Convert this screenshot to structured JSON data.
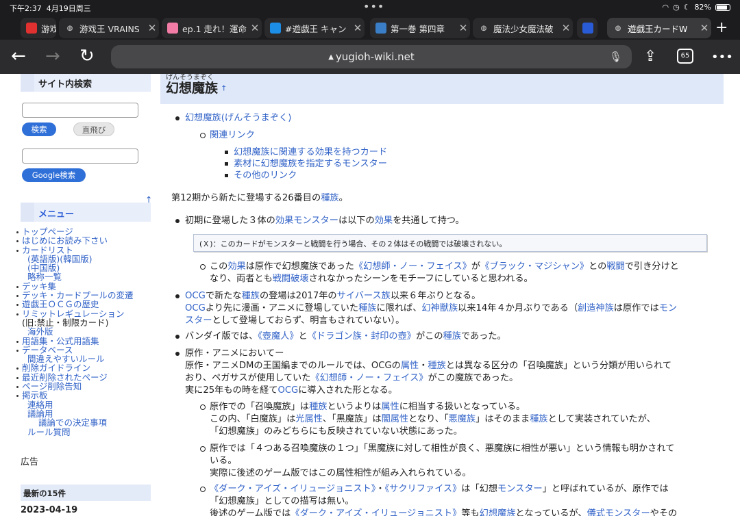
{
  "status": {
    "time": "下午2:37",
    "date": "4月19日周三",
    "battery": "82%"
  },
  "tabs": [
    {
      "label": "游戏",
      "icon": "yugioh-red-icon",
      "color": "#e03030"
    },
    {
      "label": "游戏王 VRAINS",
      "icon": "globe-icon",
      "color": "#888"
    },
    {
      "label": "ep.1 走れ！運命",
      "icon": "bilibili-icon",
      "color": "#f27ca5"
    },
    {
      "label": "#遊戯王 キャン",
      "icon": "pixiv-icon",
      "color": "#1d8ee8"
    },
    {
      "label": "第一巻 第四章",
      "icon": "book-icon",
      "color": "#3a7ec8"
    },
    {
      "label": "魔法少女魔法破",
      "icon": "globe-icon",
      "color": "#888"
    },
    {
      "label": "",
      "icon": "small-blue-icon",
      "color": "#2a5bd7"
    },
    {
      "label": "遊戯王カードW",
      "icon": "globe-icon",
      "color": "#888"
    }
  ],
  "toolbar": {
    "url": "yugioh-wiki.net",
    "tab_count": "65",
    "new_tab": "+"
  },
  "sidebar": {
    "search_title": "サイト内検索",
    "search_btn": "検索",
    "jump_btn": "直飛び",
    "google_btn": "Google検索",
    "up_arrow": "↑",
    "menu_title": "メニュー",
    "menu": [
      {
        "t": "トップページ",
        "k": "b"
      },
      {
        "t": "はじめにお読み下さい",
        "k": "b"
      },
      {
        "t": "カードリスト",
        "k": "b"
      },
      {
        "t": "(英語版)(韓国版)",
        "k": "l2"
      },
      {
        "t": "(中国版)",
        "k": "l2"
      },
      {
        "t": "略称一覧",
        "k": "l2"
      },
      {
        "t": "デッキ集",
        "k": "b"
      },
      {
        "t": "デッキ・カードプールの変遷",
        "k": "b"
      },
      {
        "t": "遊戯王ＯＣＧの歴史",
        "k": "b"
      },
      {
        "t": "リミットレギュレーション",
        "k": "b"
      },
      {
        "t": "(旧:禁止・制限カード)",
        "k": "l1"
      },
      {
        "t": "海外版",
        "k": "l2"
      },
      {
        "t": "用語集・公式用語集",
        "k": "b"
      },
      {
        "t": "データベース",
        "k": "b"
      },
      {
        "t": "間違えやすいルール",
        "k": "l2"
      },
      {
        "t": "削除ガイドライン",
        "k": "b"
      },
      {
        "t": "最近削除されたページ",
        "k": "b"
      },
      {
        "t": "ページ削除告知",
        "k": "b"
      },
      {
        "t": "掲示板",
        "k": "b"
      },
      {
        "t": "連絡用",
        "k": "l2"
      },
      {
        "t": "議論用",
        "k": "l2"
      },
      {
        "t": "議論での決定事項",
        "k": "l3"
      },
      {
        "t": "ルール質問",
        "k": "l2"
      }
    ],
    "ad_label": "広告",
    "recent_title": "最新の15件",
    "recent_date": "2023-04-19"
  },
  "article": {
    "ruby": "げんそうまぞく",
    "title": "幻想魔族",
    "dagger": "†",
    "toc1": "幻想魔族(げんそうまぞく)",
    "toc2": "関連リンク",
    "toc3": [
      "幻想魔族に関連する効果を持つカード",
      "素材に幻想魔族を指定するモンスター",
      "その他のリンク"
    ],
    "intro": [
      "第12期から新たに登場する26番目の",
      "種族",
      "。"
    ],
    "b1": [
      "初期に登場した３体の",
      "効果モンスター",
      "は以下の",
      "効果",
      "を共通して持つ。"
    ],
    "effect": "(Ｘ)：このカードがモンスターと戦闘を行う場合、その２体はその戦闘では破壊されない。",
    "c1a": [
      "この",
      "効果",
      "は原作で幻想魔族であった",
      "《幻想師・ノー・フェイス》",
      "が",
      "《ブラック・マジシャン》",
      "との",
      "戦闘",
      "で引き分けと"
    ],
    "c1b": [
      "なり、両者とも",
      "戦闘破壊",
      "されなかったシーンをモチーフにしていると思われる。"
    ],
    "b2a": [
      "OCG",
      "で新たな",
      "種族",
      "の登場は2017年の",
      "サイバース族",
      "以来６年ぶりとなる。"
    ],
    "b2b": [
      "OCG",
      "より先に漫画・アニメに登場していた",
      "種族",
      "に限れば、",
      "幻神獣族",
      "以来14年４か月ぶりである（",
      "創造神族",
      "は原作では",
      "モン"
    ],
    "b2c": [
      "スター",
      "として登場しておらず、明言もされていない）。"
    ],
    "b3": [
      "バンダイ版では、",
      "《壺魔人》",
      "と",
      "《ドラゴン族・封印の壺》",
      "がこの",
      "種族",
      "であった。"
    ],
    "b4a": "原作・アニメにおいてー",
    "b4b": [
      "原作・アニメDMの王国編までのルールでは、OCGの",
      "属性",
      "・",
      "種族",
      "とは異なる区分の「召喚魔族」という分類が用いられて"
    ],
    "b4c": [
      "おり、ペガサスが使用していた",
      "《幻想師・ノー・フェイス》",
      "がこの魔族であった。"
    ],
    "b4d": [
      "実に25年もの時を経て",
      "OCG",
      "に導入された形となる。"
    ],
    "c2a": [
      "原作での「召喚魔族」は",
      "種族",
      "というよりは",
      "属性",
      "に相当する扱いとなっている。"
    ],
    "c2b": [
      "この内、「白魔族」は",
      "光属性",
      "、「黒魔族」は",
      "闇属性",
      "となり、「",
      "悪魔族",
      "」はそのまま",
      "種族",
      "として実装されていたが、"
    ],
    "c2c": "「幻想魔族」のみどちらにも反映されていない状態にあった。",
    "c3a": "原作では「４つある召喚魔族の１つ」「黒魔族に対して相性が良く、悪魔族に相性が悪い」という情報も明かされて",
    "c3b": "いる。",
    "c3c": "実際に後述のゲーム版ではこの属性相性が組み入れられている。",
    "c4a": [
      "《ダーク・アイズ・イリュージョニスト》",
      "・",
      "《サクリファイス》",
      "は「幻想",
      "モンスター",
      "」と呼ばれているが、原作では"
    ],
    "c4b": "「幻想魔族」としての描写は無い。",
    "c4c": [
      "後述のゲーム版では",
      "《ダーク・アイズ・イリュージョニスト》",
      "等も",
      "幻想魔族",
      "となっているが、",
      "儀式モンスター",
      "やその"
    ]
  }
}
